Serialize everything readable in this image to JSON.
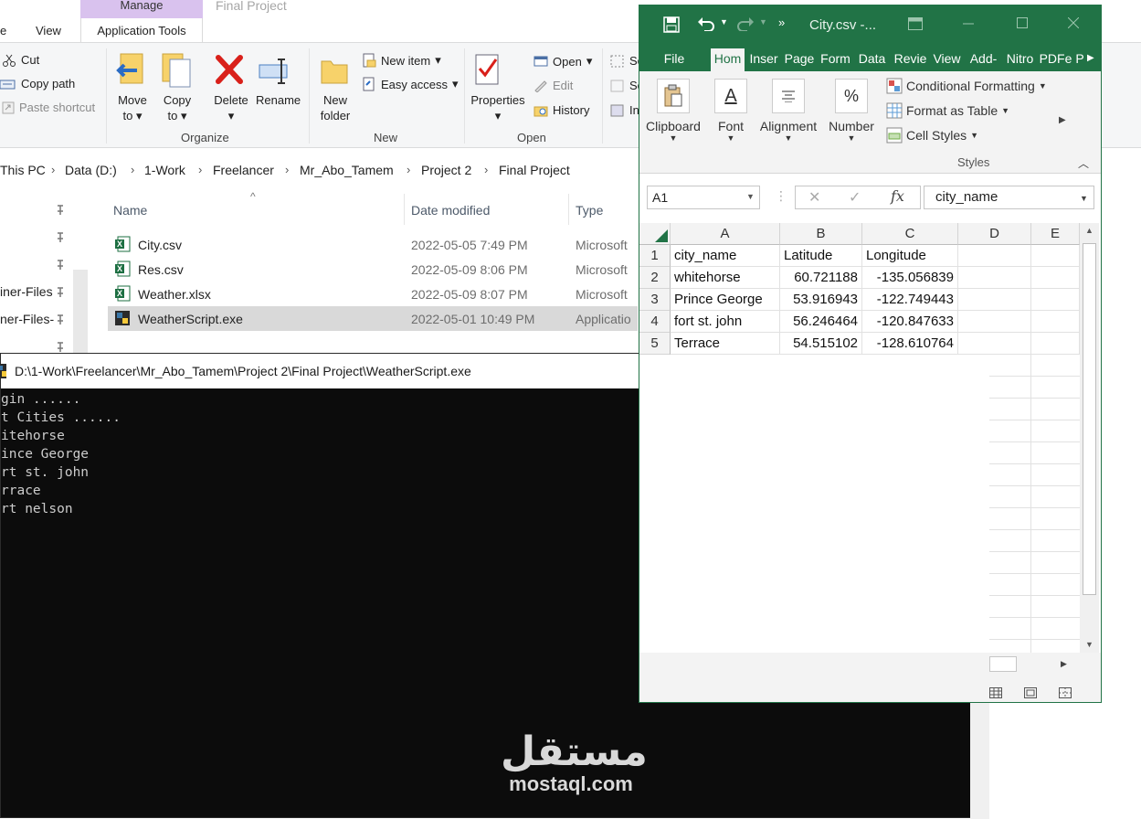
{
  "explorer": {
    "window_title": "Final Project",
    "context_tab_group": "Manage",
    "tabs": {
      "partial_home": "e",
      "view": "View",
      "app_tools": "Application Tools"
    },
    "clipboard": {
      "cut": "Cut",
      "copy_path": "Copy path",
      "paste_shortcut": "Paste shortcut"
    },
    "organize": {
      "move_to": [
        "Move",
        "to"
      ],
      "copy_to": [
        "Copy",
        "to"
      ],
      "delete": "Delete",
      "rename": "Rename",
      "label": "Organize"
    },
    "new_group": {
      "new_item": "New item",
      "easy_access": "Easy access",
      "new_folder": [
        "New",
        "folder"
      ],
      "label": "New"
    },
    "open_group": {
      "properties": "Properties",
      "open": "Open",
      "edit": "Edit",
      "history": "History",
      "label": "Open"
    },
    "select_partial": [
      "Se",
      "Se",
      "In"
    ],
    "breadcrumbs": [
      "This PC",
      "Data (D:)",
      "1-Work",
      "Freelancer",
      "Mr_Abo_Tamem",
      "Project 2",
      "Final Project"
    ],
    "nav_items": [
      "iner-Files",
      "ner-Files-"
    ],
    "columns": {
      "name": "Name",
      "date": "Date modified",
      "type": "Type"
    },
    "files": [
      {
        "name": "City.csv",
        "date": "2022-05-05 7:49 PM",
        "type": "Microsoft",
        "icon": "excel-icon"
      },
      {
        "name": "Res.csv",
        "date": "2022-05-09 8:06 PM",
        "type": "Microsoft",
        "icon": "excel-icon"
      },
      {
        "name": "Weather.xlsx",
        "date": "2022-05-09 8:07 PM",
        "type": "Microsoft",
        "icon": "excel-icon"
      },
      {
        "name": "WeatherScript.exe",
        "date": "2022-05-01 10:49 PM",
        "type": "Applicatio",
        "icon": "python-exe-icon"
      }
    ]
  },
  "console": {
    "title": "D:\\1-Work\\Freelancer\\Mr_Abo_Tamem\\Project 2\\Final Project\\WeatherScript.exe",
    "output": "gin ......\nt Cities ......\nitehorse\nince George\nrt st. john\nrrace\nrt nelson"
  },
  "excel": {
    "title": "City.csv -...",
    "tabs": [
      "File",
      "Hom",
      "Inser",
      "Page",
      "Form",
      "Data",
      "Revie",
      "View",
      "Add-",
      "Nitro",
      "PDFe",
      "P"
    ],
    "ribbon": {
      "clipboard": "Clipboard",
      "font": "Font",
      "alignment": "Alignment",
      "number": "Number",
      "percent_symbol": "%",
      "font_symbol": "A",
      "conditional_formatting": "Conditional Formatting",
      "format_as_table": "Format as Table",
      "cell_styles": "Cell Styles",
      "styles_label": "Styles"
    },
    "name_box": "A1",
    "formula_value": "city_name",
    "col_heads": [
      "A",
      "B",
      "C",
      "D",
      "E"
    ],
    "rows": [
      {
        "n": "1",
        "a": "city_name",
        "b": "Latitude",
        "c": "Longitude"
      },
      {
        "n": "2",
        "a": "whitehorse",
        "b": "60.721188",
        "c": "-135.056839"
      },
      {
        "n": "3",
        "a": "Prince George",
        "b": "53.916943",
        "c": "-122.749443"
      },
      {
        "n": "4",
        "a": "fort st. john",
        "b": "56.246464",
        "c": "-120.847633"
      },
      {
        "n": "5",
        "a": "Terrace",
        "b": "54.515102",
        "c": "-128.610764"
      }
    ],
    "accent": "#217346"
  },
  "watermark": {
    "arabic": "مستقل",
    "latin": "mostaql.com"
  }
}
